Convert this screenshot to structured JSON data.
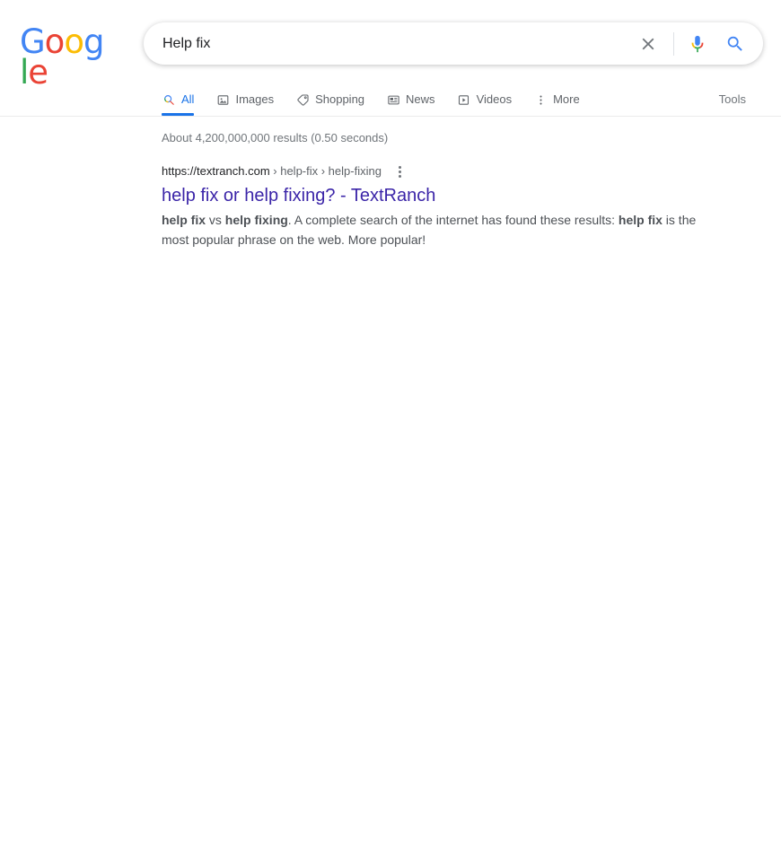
{
  "brand": {
    "name": "Google",
    "letters": [
      {
        "ch": "G",
        "color": "#4285f4"
      },
      {
        "ch": "o",
        "color": "#ea4335"
      },
      {
        "ch": "o",
        "color": "#fbbc05"
      },
      {
        "ch": "g",
        "color": "#4285f4"
      },
      {
        "ch": "l",
        "color": "#34a853"
      },
      {
        "ch": "e",
        "color": "#ea4335"
      }
    ]
  },
  "search": {
    "value": "Help fix",
    "placeholder": "Search",
    "clear_icon": "close-icon",
    "voice_icon": "microphone-icon",
    "submit_icon": "search-icon"
  },
  "nav": {
    "tabs": [
      {
        "label": "All",
        "icon": "search-icon",
        "active": true
      },
      {
        "label": "Images",
        "icon": "image-icon",
        "active": false
      },
      {
        "label": "Shopping",
        "icon": "tag-icon",
        "active": false
      },
      {
        "label": "News",
        "icon": "newspaper-icon",
        "active": false
      },
      {
        "label": "Videos",
        "icon": "video-play-icon",
        "active": false
      },
      {
        "label": "More",
        "icon": "more-vertical-icon",
        "active": false
      }
    ],
    "tools_label": "Tools"
  },
  "results": {
    "stats": "About 4,200,000,000 results (0.50 seconds)",
    "items": [
      {
        "url_domain": "https://textranch.com",
        "url_path": " › help-fix › help-fixing",
        "title": "help fix or help fixing? - TextRanch",
        "snippet_html": "<b>help fix</b> vs <b>help fixing</b>. A complete search of the internet has found these results: <b>help fix</b> is the most popular phrase on the web. More popular!",
        "kebab_icon": "more-vertical-icon"
      }
    ]
  },
  "colors": {
    "google_blue": "#4285f4",
    "google_red": "#ea4335",
    "google_yellow": "#fbbc05",
    "google_green": "#34a853",
    "link_visited": "#3b25a8",
    "active_tab": "#1a73e8",
    "text_gray": "#70757a"
  }
}
